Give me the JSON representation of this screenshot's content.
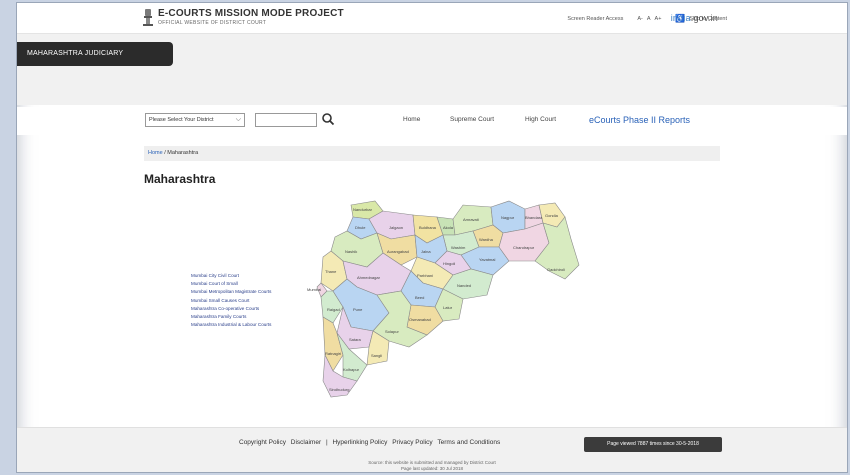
{
  "header": {
    "title": "E-COURTS MISSION MODE PROJECT",
    "subtitle": "OFFICIAL WEBSITE OF DISTRICT COURT",
    "screen_reader": "Screen Reader Access",
    "font_small": "A-",
    "font_normal": "A",
    "font_large": "A+",
    "skip_content": "Skip to Content",
    "india_gov_left": "india",
    "india_gov_right": ".gov.in"
  },
  "band": {
    "judiciary_label": "MAHARASHTRA JUDICIARY"
  },
  "nav": {
    "district_placeholder": "Please Select Your District",
    "home": "Home",
    "supreme_court": "Supreme Court",
    "high_court": "High Court",
    "reports": "eCourts Phase II Reports"
  },
  "breadcrumb": {
    "home": "Home",
    "current": "Maharashtra"
  },
  "page": {
    "title": "Maharashtra"
  },
  "legend": [
    "Mumbai City Civil Court",
    "Mumbai Court of Small",
    "Mumbai Metropolitan Magistrate Courts",
    "Mumbai Small Causes Court",
    "Maharashtra Co-operative Courts",
    "Maharashtra Family Courts",
    "Maharashtra Industrial & Labour Courts"
  ],
  "map_labels": {
    "nandurbar": "Nandurbar",
    "dhule": "Dhule",
    "jalgaon": "Jalgaon",
    "buldhana": "Buldhana",
    "akola": "Akola",
    "amravati": "Amravati",
    "nagpur": "Nagpur",
    "bhandara": "Bhandara",
    "gondia": "Gondia",
    "wardha": "Wardha",
    "washim": "Washim",
    "yavatmal": "Yavatmal",
    "chandrapur": "Chandrapur",
    "gadchiroli": "Gadchiroli",
    "nashik": "Nashik",
    "aurangabad": "Aurangabad",
    "jalna": "Jalna",
    "hingoli": "Hingoli",
    "parbhani": "Parbhani",
    "nanded": "Nanded",
    "thane": "Thane",
    "ahmednagar": "Ahmednagar",
    "beed": "Beed",
    "latur": "Latur",
    "pune": "Pune",
    "raigad": "Raigad",
    "osmanabad": "Osmanabad",
    "solapur": "Solapur",
    "satara": "Satara",
    "sangli": "Sangli",
    "ratnagiri": "Ratnagiri",
    "kolhapur": "Kolhapur",
    "sindhudurg": "Sindhudurg",
    "mumbai": "Mumbai"
  },
  "footer": {
    "copyright": "Copyright Policy",
    "disclaimer": "Disclaimer",
    "hyperlinking": "Hyperlinking Policy",
    "privacy": "Privacy Policy",
    "terms": "Terms and Conditions",
    "visitor": "Page viewed 7887 times since 30-5-2018",
    "note1": "Source: this website is submitted and managed by District Court",
    "note2": "Page last updated: 30 Jul 2018"
  },
  "colors": {
    "accent_link": "#2a62b8",
    "band_tab": "#2b2b2b",
    "footer_badge": "#3b3b3b"
  }
}
